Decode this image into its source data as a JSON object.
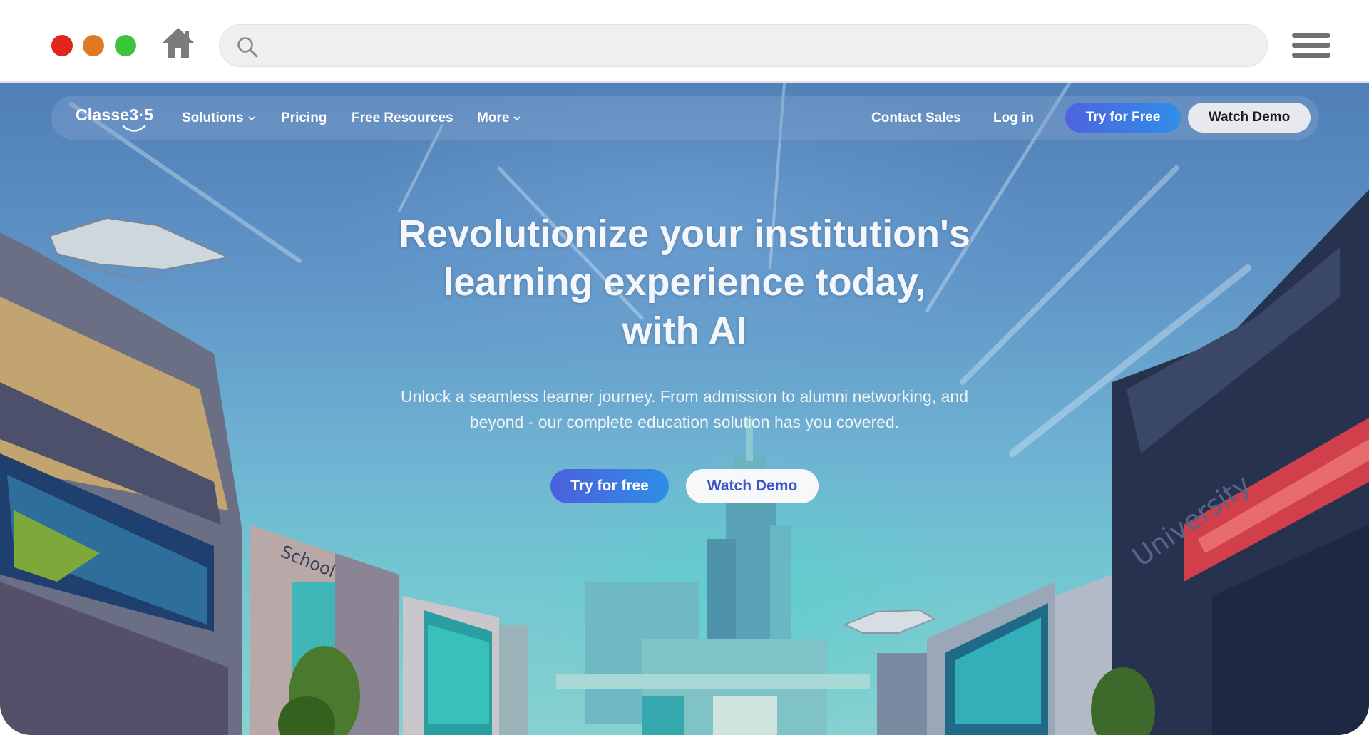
{
  "browser": {
    "window_buttons": [
      "close",
      "minimize",
      "maximize"
    ],
    "home_icon": "home-icon",
    "address_bar": {
      "value": "",
      "icon": "search-icon"
    },
    "menu_icon": "hamburger-menu-icon"
  },
  "navbar": {
    "logo": "Classe365",
    "logo_display": "Classe3·5",
    "items": [
      {
        "label": "Solutions",
        "dropdown": true
      },
      {
        "label": "Pricing",
        "dropdown": false
      },
      {
        "label": "Free Resources",
        "dropdown": false
      },
      {
        "label": "More",
        "dropdown": true
      }
    ],
    "contact_sales": "Contact Sales",
    "login": "Log in",
    "try_free": "Try for Free",
    "watch_demo": "Watch Demo"
  },
  "hero": {
    "headline_lines": [
      "Revolutionize your institution's",
      "learning experience today,",
      "with AI"
    ],
    "subtext_lines": [
      "Unlock a seamless learner journey. From admission to alumni networking, and",
      "beyond - our complete education solution has you covered."
    ],
    "cta_primary": "Try for free",
    "cta_secondary": "Watch Demo",
    "background_signs": {
      "left_building": "School",
      "right_building": "University"
    }
  },
  "colors": {
    "primary_button": "#3a74e6",
    "secondary_button_text": "#3b55c9",
    "traffic_red": "#e0251f",
    "traffic_orange": "#e07a21",
    "traffic_green": "#3cc43a"
  }
}
